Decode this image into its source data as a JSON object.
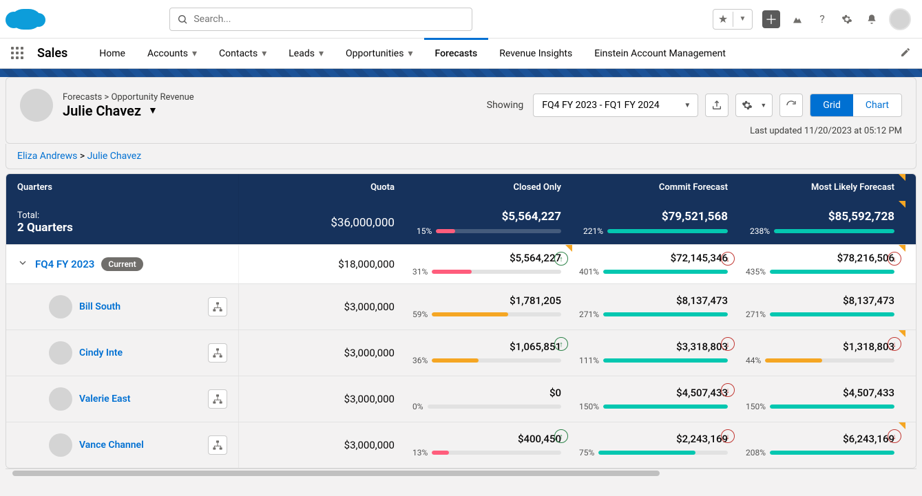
{
  "search": {
    "placeholder": "Search..."
  },
  "app": {
    "name": "Sales"
  },
  "nav": {
    "items": [
      {
        "label": "Home",
        "chev": false
      },
      {
        "label": "Accounts",
        "chev": true
      },
      {
        "label": "Contacts",
        "chev": true
      },
      {
        "label": "Leads",
        "chev": true
      },
      {
        "label": "Opportunities",
        "chev": true
      },
      {
        "label": "Forecasts",
        "chev": false,
        "active": true
      },
      {
        "label": "Revenue Insights",
        "chev": false
      },
      {
        "label": "Einstein Account Management",
        "chev": false
      }
    ]
  },
  "pageHeader": {
    "breadcrumb": "Forecasts > Opportunity Revenue",
    "title": "Julie Chavez",
    "showingLabel": "Showing",
    "range": "FQ4 FY 2023 - FQ1 FY 2024",
    "grid": "Grid",
    "chart": "Chart",
    "lastUpdated": "Last updated 11/20/2023 at 05:12 PM"
  },
  "crumbs": {
    "a": "Eliza Andrews",
    "sep": " > ",
    "b": "Julie Chavez"
  },
  "columns": {
    "quarters": "Quarters",
    "quota": "Quota",
    "closed": "Closed Only",
    "commit": "Commit Forecast",
    "mostlikely": "Most Likely Forecast"
  },
  "total": {
    "label": "Total:",
    "periods": "2 Quarters",
    "quota": "$36,000,000",
    "closed": {
      "value": "$5,564,227",
      "pct": "15%",
      "fill": 15,
      "color": "#ff5d7c"
    },
    "commit": {
      "value": "$79,521,568",
      "pct": "221%",
      "fill": 100,
      "color": "#04c7b0"
    },
    "mostlikely": {
      "value": "$85,592,728",
      "pct": "238%",
      "fill": 100,
      "color": "#04c7b0"
    }
  },
  "quarterRow": {
    "label": "FQ4 FY 2023",
    "badge": "Current",
    "quota": "$18,000,000",
    "closed": {
      "value": "$5,564,227",
      "pct": "31%",
      "fill": 31,
      "color": "#ff5d7c",
      "trend": "up"
    },
    "commit": {
      "value": "$72,145,346",
      "pct": "401%",
      "fill": 100,
      "color": "#04c7b0",
      "trend": "down"
    },
    "mostlikely": {
      "value": "$78,216,506",
      "pct": "435%",
      "fill": 100,
      "color": "#04c7b0",
      "trend": "down"
    }
  },
  "people": [
    {
      "name": "Bill South",
      "quota": "$3,000,000",
      "closed": {
        "value": "$1,781,205",
        "pct": "59%",
        "fill": 59,
        "color": "#f5a623"
      },
      "commit": {
        "value": "$8,137,473",
        "pct": "271%",
        "fill": 100,
        "color": "#04c7b0"
      },
      "mostlikely": {
        "value": "$8,137,473",
        "pct": "271%",
        "fill": 100,
        "color": "#04c7b0"
      }
    },
    {
      "name": "Cindy Inte",
      "quota": "$3,000,000",
      "closed": {
        "value": "$1,065,851",
        "pct": "36%",
        "fill": 36,
        "color": "#f5a623",
        "trend": "up"
      },
      "commit": {
        "value": "$3,318,803",
        "pct": "111%",
        "fill": 100,
        "color": "#04c7b0",
        "trend": "down"
      },
      "mostlikely": {
        "value": "$1,318,803",
        "pct": "44%",
        "fill": 44,
        "color": "#f5a623",
        "trend": "down"
      }
    },
    {
      "name": "Valerie East",
      "quota": "$3,000,000",
      "closed": {
        "value": "$0",
        "pct": "0%",
        "fill": 0,
        "color": "#f5a623"
      },
      "commit": {
        "value": "$4,507,433",
        "pct": "150%",
        "fill": 100,
        "color": "#04c7b0",
        "trend": "down"
      },
      "mostlikely": {
        "value": "$4,507,433",
        "pct": "150%",
        "fill": 100,
        "color": "#04c7b0"
      }
    },
    {
      "name": "Vance Channel",
      "quota": "$3,000,000",
      "closed": {
        "value": "$400,450",
        "pct": "13%",
        "fill": 13,
        "color": "#ff5d7c",
        "trend": "up"
      },
      "commit": {
        "value": "$2,243,169",
        "pct": "75%",
        "fill": 75,
        "color": "#04c7b0",
        "trend": "down"
      },
      "mostlikely": {
        "value": "$6,243,169",
        "pct": "208%",
        "fill": 100,
        "color": "#04c7b0",
        "trend": "down"
      }
    }
  ]
}
